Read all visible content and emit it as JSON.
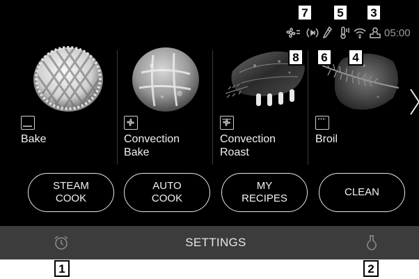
{
  "status": {
    "clock": "05:00",
    "icons": [
      "fan-icon",
      "remote-start-icon",
      "probe-icon",
      "thermometer-icon",
      "wifi-icon",
      "user-icon"
    ]
  },
  "callouts": [
    "1",
    "2",
    "3",
    "4",
    "5",
    "6",
    "7",
    "8"
  ],
  "modes": [
    {
      "label": "Bake",
      "icon": "bake-mode-icon"
    },
    {
      "label": "Convection\nBake",
      "icon": "convection-fan-icon"
    },
    {
      "label": "Convection\nRoast",
      "icon": "convection-fan-icon"
    },
    {
      "label": "Broil",
      "icon": "broil-mode-icon"
    }
  ],
  "buttons": [
    {
      "label": "STEAM\nCOOK"
    },
    {
      "label": "AUTO\nCOOK"
    },
    {
      "label": "MY\nRECIPES"
    },
    {
      "label": "CLEAN"
    }
  ],
  "bottom": {
    "settings_label": "SETTINGS",
    "left_icon": "timer-alarm-icon",
    "right_icon": "meat-probe-icon"
  },
  "colors": {
    "screen_bg": "#000000",
    "bottom_bar": "#3c3c3c",
    "text": "#f2f2f2",
    "dim_icon": "#9a9a9a"
  }
}
